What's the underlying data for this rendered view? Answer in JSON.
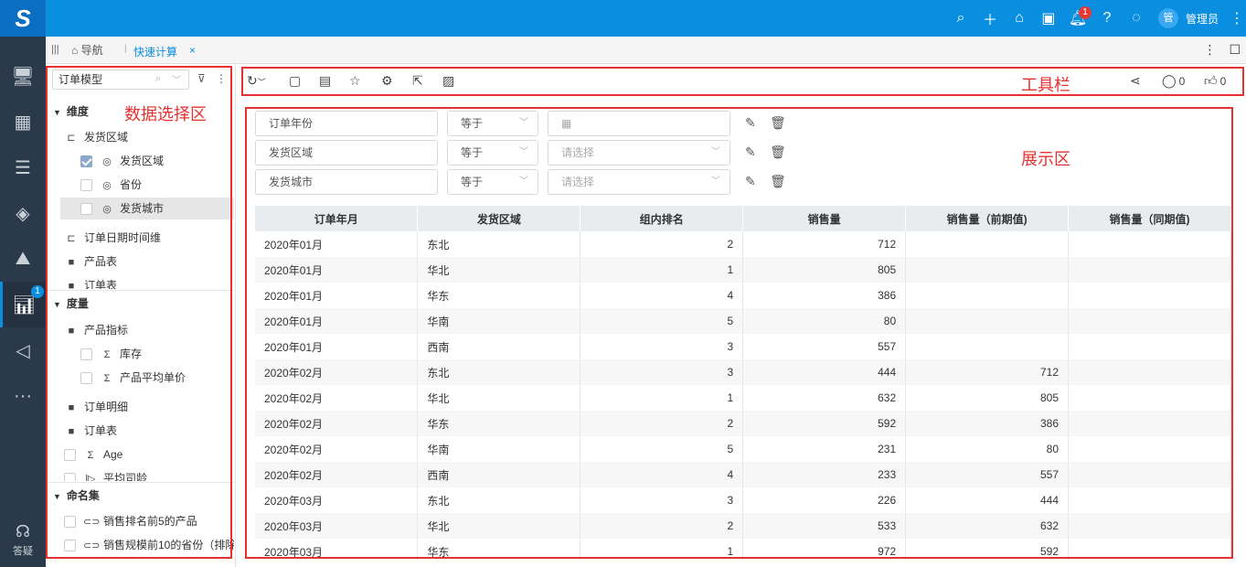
{
  "app": {
    "logo": "S",
    "user_initial": "管",
    "username": "管理员",
    "notification_count": "1"
  },
  "nav": {
    "badge": "1",
    "help_label": "答疑"
  },
  "tabs": {
    "home_label": "导航",
    "active_label": "快速计算",
    "close": "×"
  },
  "left_panel": {
    "model_value": "订单模型",
    "dimension_header": "维度",
    "dims": [
      {
        "label": "发货区域",
        "kind": "hierarchy"
      },
      {
        "label": "发货区域",
        "kind": "field",
        "checked": true
      },
      {
        "label": "省份",
        "kind": "field",
        "checked": false
      },
      {
        "label": "发货城市",
        "kind": "field",
        "checked": false,
        "selected": true
      },
      {
        "label": "订单日期时间维",
        "kind": "hierarchy"
      },
      {
        "label": "产品表",
        "kind": "folder"
      },
      {
        "label": "订单表",
        "kind": "folder"
      }
    ],
    "measure_header": "度量",
    "measures": [
      {
        "label": "产品指标",
        "kind": "folder"
      },
      {
        "label": "库存",
        "kind": "sum"
      },
      {
        "label": "产品平均单价",
        "kind": "sum"
      },
      {
        "label": "订单明细",
        "kind": "folder"
      },
      {
        "label": "订单表",
        "kind": "folder"
      },
      {
        "label": "Age",
        "kind": "sum"
      },
      {
        "label": "平均司龄",
        "kind": "calc"
      }
    ],
    "named_set_header": "命名集",
    "named_sets": [
      "销售排名前5的产品",
      "销售规模前10的省份（排除"
    ]
  },
  "annotations": {
    "data_area": "数据选择区",
    "toolbar": "工具栏",
    "display": "展示区"
  },
  "toolbar": {
    "share_icon": "share-icon",
    "comment_count": "0",
    "like_count": "0"
  },
  "filters": [
    {
      "field": "订单年份",
      "op": "等于",
      "value": "",
      "value_type": "date"
    },
    {
      "field": "发货区域",
      "op": "等于",
      "value": "请选择",
      "value_type": "select"
    },
    {
      "field": "发货城市",
      "op": "等于",
      "value": "请选择",
      "value_type": "select"
    }
  ],
  "table": {
    "headers": [
      "订单年月",
      "发货区域",
      "组内排名",
      "销售量",
      "销售量（前期值)",
      "销售量（同期值)"
    ],
    "rows": [
      [
        "2020年01月",
        "东北",
        "2",
        "712",
        "",
        ""
      ],
      [
        "2020年01月",
        "华北",
        "1",
        "805",
        "",
        ""
      ],
      [
        "2020年01月",
        "华东",
        "4",
        "386",
        "",
        ""
      ],
      [
        "2020年01月",
        "华南",
        "5",
        "80",
        "",
        ""
      ],
      [
        "2020年01月",
        "西南",
        "3",
        "557",
        "",
        ""
      ],
      [
        "2020年02月",
        "东北",
        "3",
        "444",
        "712",
        ""
      ],
      [
        "2020年02月",
        "华北",
        "1",
        "632",
        "805",
        ""
      ],
      [
        "2020年02月",
        "华东",
        "2",
        "592",
        "386",
        ""
      ],
      [
        "2020年02月",
        "华南",
        "5",
        "231",
        "80",
        ""
      ],
      [
        "2020年02月",
        "西南",
        "4",
        "233",
        "557",
        ""
      ],
      [
        "2020年03月",
        "东北",
        "3",
        "226",
        "444",
        ""
      ],
      [
        "2020年03月",
        "华北",
        "2",
        "533",
        "632",
        ""
      ],
      [
        "2020年03月",
        "华东",
        "1",
        "972",
        "592",
        ""
      ]
    ]
  }
}
